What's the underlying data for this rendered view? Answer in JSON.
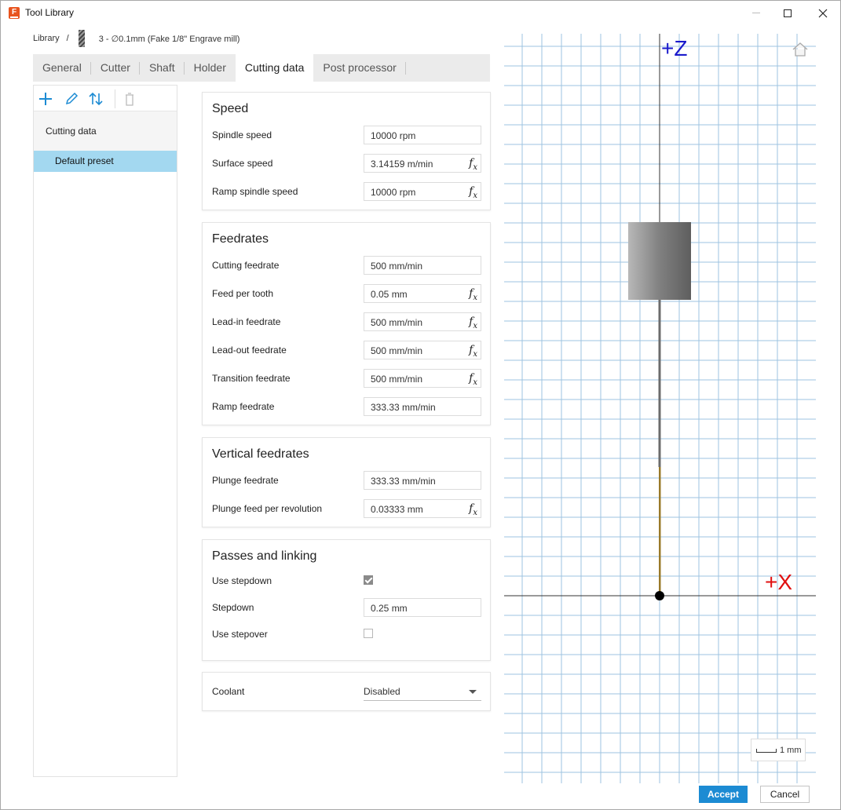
{
  "window": {
    "title": "Tool Library"
  },
  "breadcrumb": {
    "library": "Library",
    "separator": "/",
    "tool": "3 - ∅0.1mm (Fake 1/8\" Engrave mill)"
  },
  "tabs": [
    {
      "label": "General"
    },
    {
      "label": "Cutter"
    },
    {
      "label": "Shaft"
    },
    {
      "label": "Holder"
    },
    {
      "label": "Cutting data",
      "active": true
    },
    {
      "label": "Post processor"
    }
  ],
  "left_panel": {
    "toolbar": [
      "add-icon",
      "edit-icon",
      "sort-icon",
      "delete-icon"
    ],
    "section_label": "Cutting data",
    "presets": [
      {
        "label": "Default preset",
        "selected": true
      }
    ]
  },
  "speed": {
    "title": "Speed",
    "spindle_speed": {
      "label": "Spindle speed",
      "value": "10000 rpm"
    },
    "surface_speed": {
      "label": "Surface speed",
      "value": "3.14159 m/min"
    },
    "ramp_spindle_speed": {
      "label": "Ramp spindle speed",
      "value": "10000 rpm"
    }
  },
  "feedrates": {
    "title": "Feedrates",
    "cutting_feedrate": {
      "label": "Cutting feedrate",
      "value": "500 mm/min"
    },
    "feed_per_tooth": {
      "label": "Feed per tooth",
      "value": "0.05 mm"
    },
    "lead_in_feedrate": {
      "label": "Lead-in feedrate",
      "value": "500 mm/min"
    },
    "lead_out_feedrate": {
      "label": "Lead-out feedrate",
      "value": "500 mm/min"
    },
    "transition_feedrate": {
      "label": "Transition feedrate",
      "value": "500 mm/min"
    },
    "ramp_feedrate": {
      "label": "Ramp feedrate",
      "value": "333.33 mm/min"
    }
  },
  "vertical_feedrates": {
    "title": "Vertical feedrates",
    "plunge_feedrate": {
      "label": "Plunge feedrate",
      "value": "333.33 mm/min"
    },
    "plunge_feed_per_revolution": {
      "label": "Plunge feed per revolution",
      "value": "0.03333 mm"
    }
  },
  "passes": {
    "title": "Passes and linking",
    "use_stepdown": {
      "label": "Use stepdown",
      "checked": true
    },
    "stepdown": {
      "label": "Stepdown",
      "value": "0.25 mm"
    },
    "use_stepover": {
      "label": "Use stepover",
      "checked": false
    }
  },
  "coolant": {
    "label": "Coolant",
    "value": "Disabled"
  },
  "fx_label": "f",
  "fx_sub": "x",
  "viewport": {
    "z_axis_label": "+Z",
    "x_axis_label": "+X",
    "scale_label": "1 mm",
    "z_color": "#1a1acc",
    "x_color": "#e01010"
  },
  "buttons": {
    "accept": "Accept",
    "cancel": "Cancel"
  },
  "colors": {
    "accent": "#1c8bd3",
    "selection": "#a3d8f0",
    "grid": "#9ec3e0"
  }
}
